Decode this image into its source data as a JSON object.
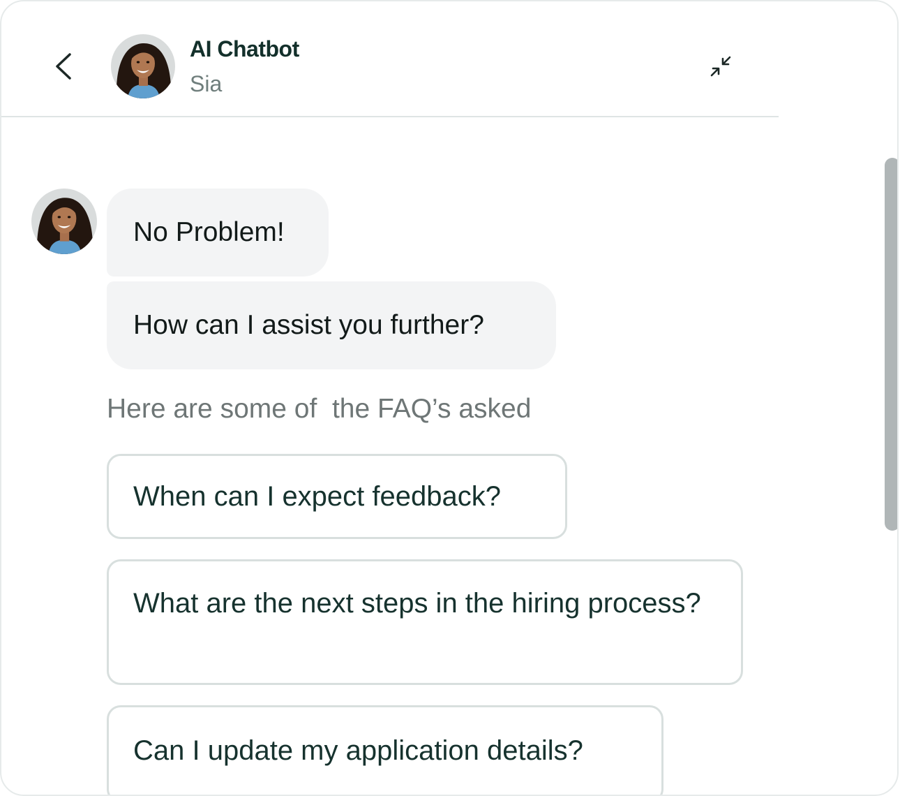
{
  "header": {
    "back_icon": "chevron-left-icon",
    "avatar_icon": "bot-avatar",
    "title": "AI Chatbot",
    "subtitle": "Sia",
    "minimize_icon": "minimize-arrows-icon"
  },
  "messages": [
    {
      "sender": "bot",
      "text": "No Problem!"
    },
    {
      "sender": "bot",
      "text": "How can I assist you further?"
    }
  ],
  "faq": {
    "intro": "Here are some of  the FAQ’s asked",
    "items": [
      {
        "label": "When can I expect feedback?"
      },
      {
        "label": "What are the next steps in the hiring process?"
      },
      {
        "label": "Can I update my application details?"
      }
    ]
  },
  "colors": {
    "bubble_bg": "#f3f4f5",
    "faq_border": "#d8dfde",
    "header_divider": "#dfe4e4",
    "scrollbar_thumb": "#b0b6b7",
    "text_primary": "#13302b",
    "text_muted": "#6f7e7c"
  },
  "scrollbar": {
    "thumb_fraction": 0.6
  }
}
